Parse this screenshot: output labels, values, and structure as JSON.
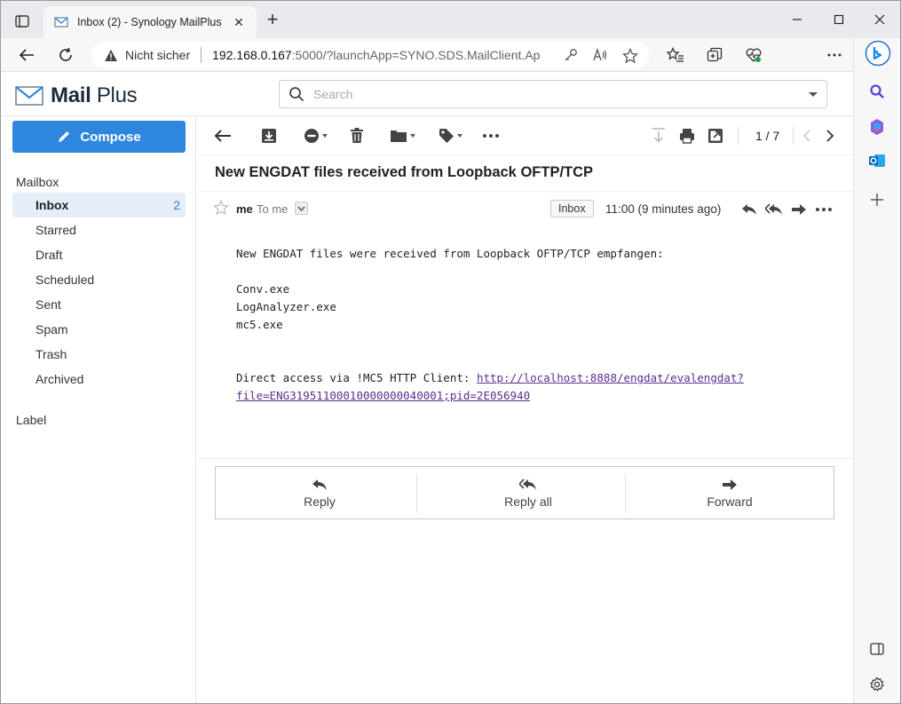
{
  "browser": {
    "tab_title": "Inbox (2) - Synology MailPlus",
    "security_label": "Nicht sicher",
    "url_host": "192.168.0.167",
    "url_rest": ":5000/?launchApp=SYNO.SDS.MailClient.Ap...",
    "accent": "#2e86de"
  },
  "app": {
    "brand_bold": "Mail",
    "brand_light": " Plus",
    "search_placeholder": "Search"
  },
  "sidebar": {
    "compose_label": "Compose",
    "mailbox_label": "Mailbox",
    "items": [
      {
        "label": "Inbox",
        "count": "2"
      },
      {
        "label": "Starred"
      },
      {
        "label": "Draft"
      },
      {
        "label": "Scheduled"
      },
      {
        "label": "Sent"
      },
      {
        "label": "Spam"
      },
      {
        "label": "Trash"
      },
      {
        "label": "Archived"
      }
    ],
    "label_section": "Label"
  },
  "toolbar": {
    "pager": "1 / 7"
  },
  "message": {
    "subject": "New ENGDAT files received from Loopback OFTP/TCP",
    "from": "me",
    "to": "To me",
    "folder": "Inbox",
    "time": "11:00 (9 minutes ago)",
    "body_intro": "New ENGDAT files were received from Loopback OFTP/TCP empfangen:",
    "files": [
      "Conv.exe",
      "LogAnalyzer.exe",
      "mc5.exe"
    ],
    "access_prefix": "Direct access via !MC5 HTTP Client: ",
    "link_line1": "http://localhost:8888/engdat/evalengdat?",
    "link_line2": "file=ENG31951100010000000040001;pid=2E056940"
  },
  "quick_reply": {
    "reply": "Reply",
    "reply_all": "Reply all",
    "forward": "Forward"
  }
}
